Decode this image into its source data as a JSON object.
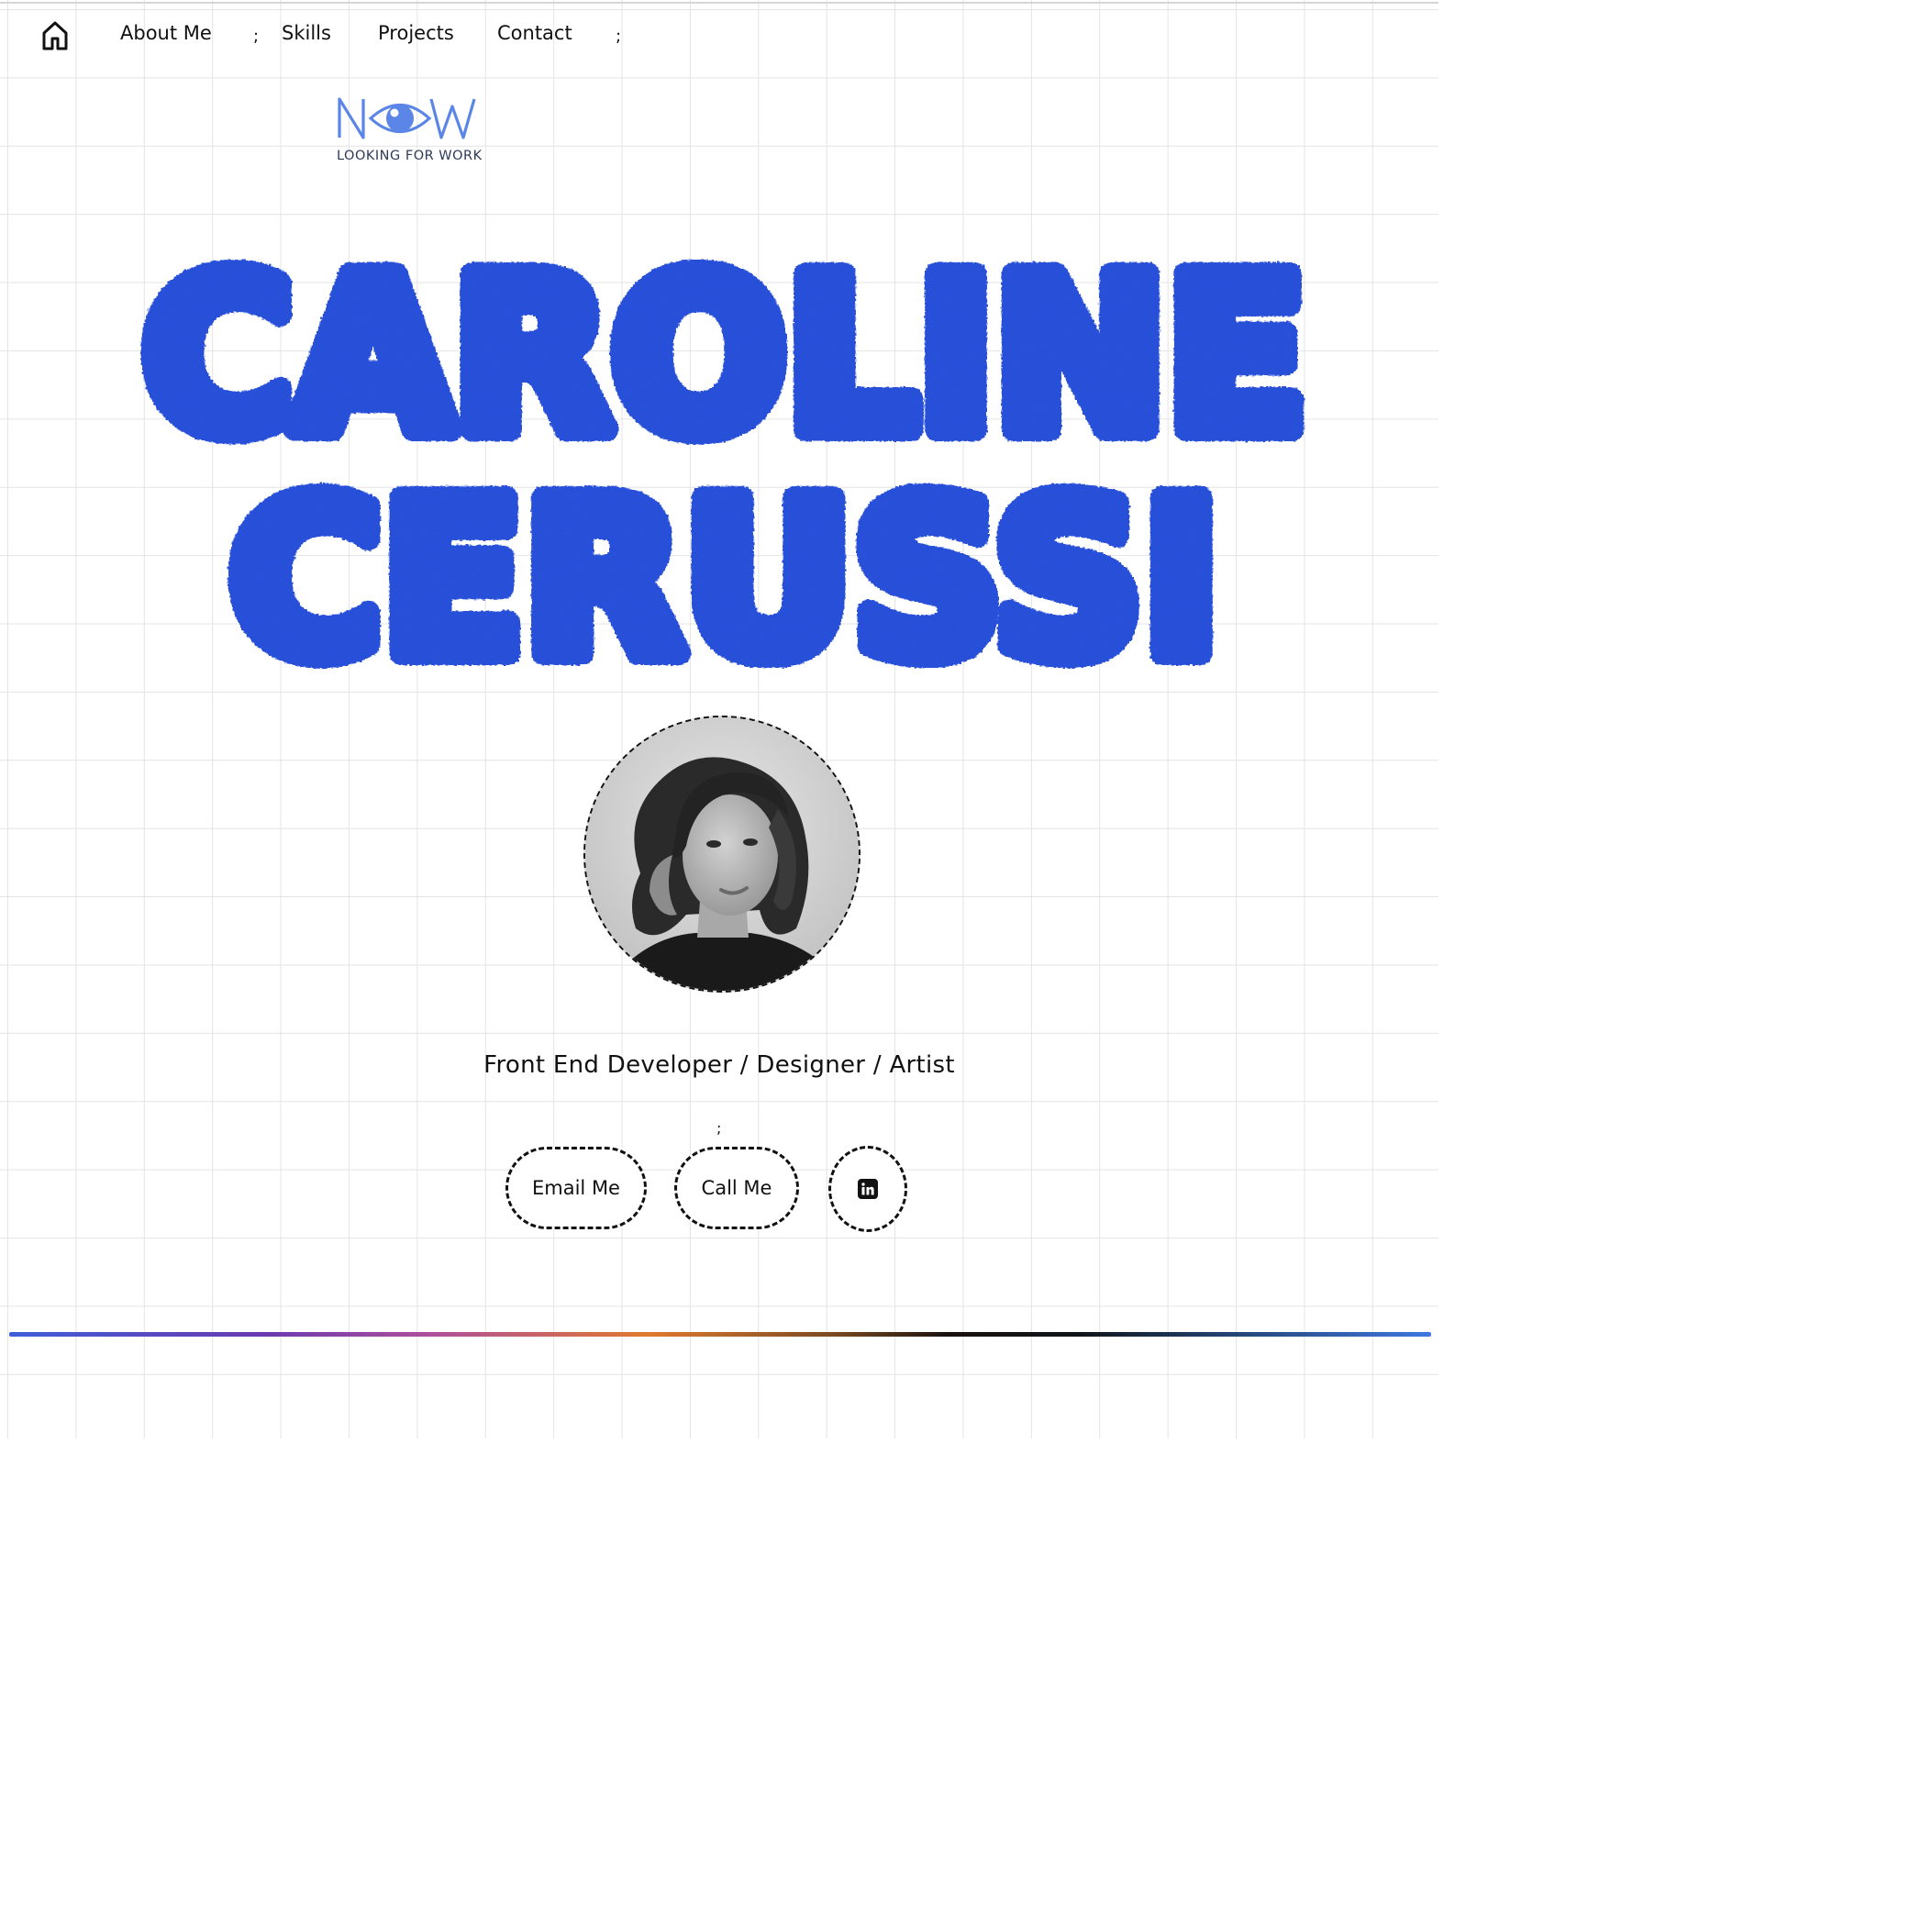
{
  "nav": {
    "home_icon": "home-icon",
    "links": [
      "About Me",
      "Skills",
      "Projects",
      "Contact"
    ],
    "separator": ";"
  },
  "badge": {
    "word": "NOW",
    "caption": "LOOKING FOR WORK",
    "icon": "eye-icon",
    "color": "#5b86e8"
  },
  "hero": {
    "line1": "CAROLINE",
    "line2": "CERUSSI",
    "color": "#1f48e0"
  },
  "profile": {
    "avatar": "profile-photo"
  },
  "subtitle": "Front End Developer / Designer / Artist",
  "separator_mid": ";",
  "actions": {
    "email_label": "Email Me",
    "call_label": "Call Me",
    "linkedin_icon": "linkedin-icon"
  },
  "colors": {
    "grid": "#e4e4e4",
    "text": "#111111",
    "accent_blue": "#1f48e0"
  }
}
